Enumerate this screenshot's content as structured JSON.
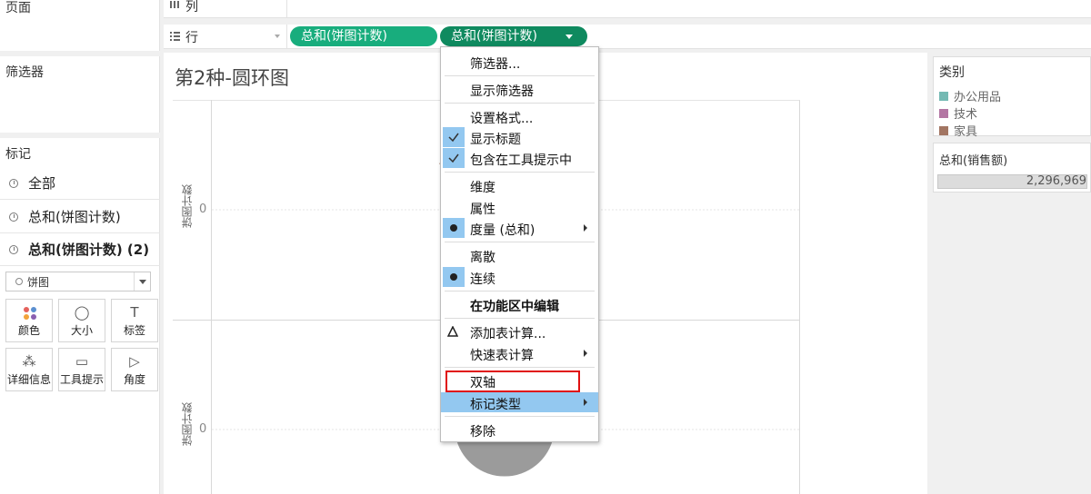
{
  "left_panel": {
    "pages_title": "页面",
    "filters_title": "筛选器",
    "marks_title": "标记",
    "mark_cards": [
      "全部",
      "总和(饼图计数)",
      "总和(饼图计数) (2)"
    ],
    "mark_type": "饼图",
    "mark_buttons": [
      "颜色",
      "大小",
      "标签",
      "详细信息",
      "工具提示",
      "角度"
    ],
    "mark_button_glyphs": [
      "●",
      "◯",
      "T",
      "⁂",
      "▭",
      "▷"
    ]
  },
  "shelves": {
    "columns_label": "列",
    "rows_label": "行",
    "row_pills": [
      "总和(饼图计数)",
      "总和(饼图计数)"
    ]
  },
  "view": {
    "title": "第2种-圆环图",
    "axis_label": "饼图计数",
    "tick_zero": "0"
  },
  "legend": {
    "title": "类别",
    "items": [
      {
        "label": "办公用品",
        "color": "#74b9b3"
      },
      {
        "label": "技术",
        "color": "#b376a3"
      },
      {
        "label": "家具",
        "color": "#a27562"
      }
    ]
  },
  "size_card": {
    "title": "总和(销售额)",
    "value": "2,296,969"
  },
  "context_menu": {
    "items": [
      "筛选器...",
      "显示筛选器",
      "设置格式...",
      "显示标题",
      "包含在工具提示中",
      "维度",
      "属性",
      "度量 (总和)",
      "离散",
      "连续",
      "在功能区中编辑",
      "添加表计算...",
      "快速表计算",
      "双轴",
      "标记类型",
      "移除"
    ]
  },
  "colors": {
    "pill_green": "#18ad7d",
    "pill_dark_green": "#0f8a5f",
    "menu_highlight": "#93c8f0",
    "red_box": "#e01010",
    "gray_pie": "#9b9b9b"
  }
}
